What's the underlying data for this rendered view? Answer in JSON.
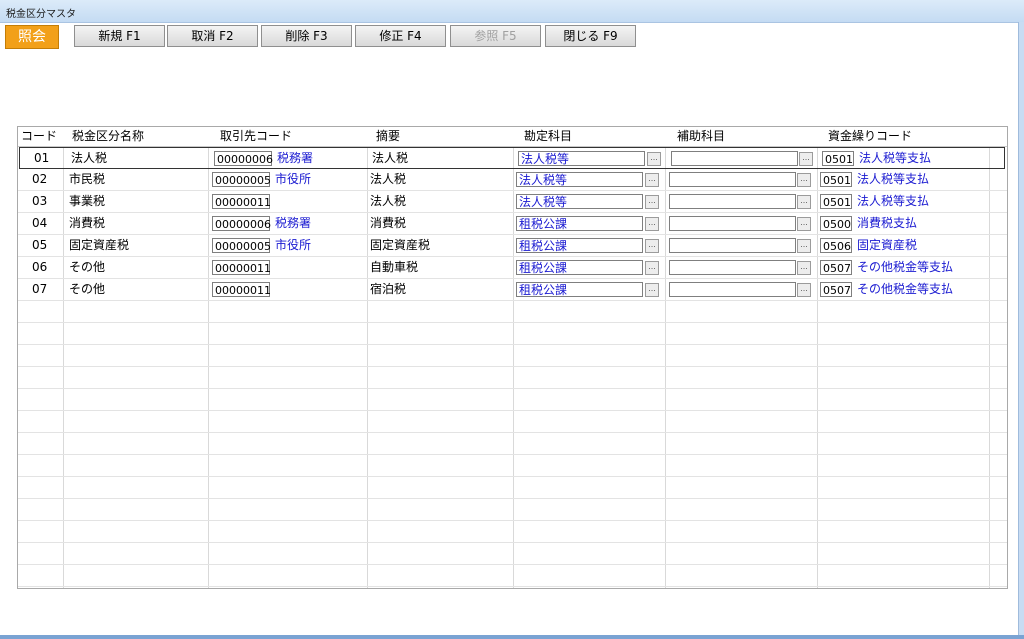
{
  "window": {
    "title": "税金区分マスタ"
  },
  "toolbar": {
    "mode": "照会",
    "buttons": [
      {
        "label": "新規 F1",
        "enabled": true
      },
      {
        "label": "取消 F2",
        "enabled": true
      },
      {
        "label": "削除 F3",
        "enabled": true
      },
      {
        "label": "修正 F4",
        "enabled": true
      },
      {
        "label": "参照 F5",
        "enabled": false
      },
      {
        "label": "閉じる F9",
        "enabled": true
      }
    ]
  },
  "grid": {
    "headers": [
      "コード",
      "税金区分名称",
      "取引先コード",
      "摘要",
      "勘定科目",
      "補助科目",
      "資金繰りコード"
    ],
    "rows": [
      {
        "code": "01",
        "name": "法人税",
        "partner_code": "00000006",
        "partner_name": "税務署",
        "summary": "法人税",
        "account": "法人税等",
        "sub_account": "",
        "fund_code": "0501",
        "fund_name": "法人税等支払"
      },
      {
        "code": "02",
        "name": "市民税",
        "partner_code": "00000005",
        "partner_name": "市役所",
        "summary": "法人税",
        "account": "法人税等",
        "sub_account": "",
        "fund_code": "0501",
        "fund_name": "法人税等支払"
      },
      {
        "code": "03",
        "name": "事業税",
        "partner_code": "00000011",
        "partner_name": "",
        "summary": "法人税",
        "account": "法人税等",
        "sub_account": "",
        "fund_code": "0501",
        "fund_name": "法人税等支払"
      },
      {
        "code": "04",
        "name": "消費税",
        "partner_code": "00000006",
        "partner_name": "税務署",
        "summary": "消費税",
        "account": "租税公課",
        "sub_account": "",
        "fund_code": "0500",
        "fund_name": "消費税支払"
      },
      {
        "code": "05",
        "name": "固定資産税",
        "partner_code": "00000005",
        "partner_name": "市役所",
        "summary": "固定資産税",
        "account": "租税公課",
        "sub_account": "",
        "fund_code": "0506",
        "fund_name": "固定資産税"
      },
      {
        "code": "06",
        "name": "その他",
        "partner_code": "00000011",
        "partner_name": "",
        "summary": "自動車税",
        "account": "租税公課",
        "sub_account": "",
        "fund_code": "0507",
        "fund_name": "その他税金等支払"
      },
      {
        "code": "07",
        "name": "その他",
        "partner_code": "00000011",
        "partner_name": "",
        "summary": "宿泊税",
        "account": "租税公課",
        "sub_account": "",
        "fund_code": "0507",
        "fund_name": "その他税金等支払"
      }
    ],
    "selected_row": 0,
    "ellipsis_label": "..."
  },
  "colors": {
    "mode_badge": "#f2a019",
    "link_text": "#1a1ad1"
  }
}
